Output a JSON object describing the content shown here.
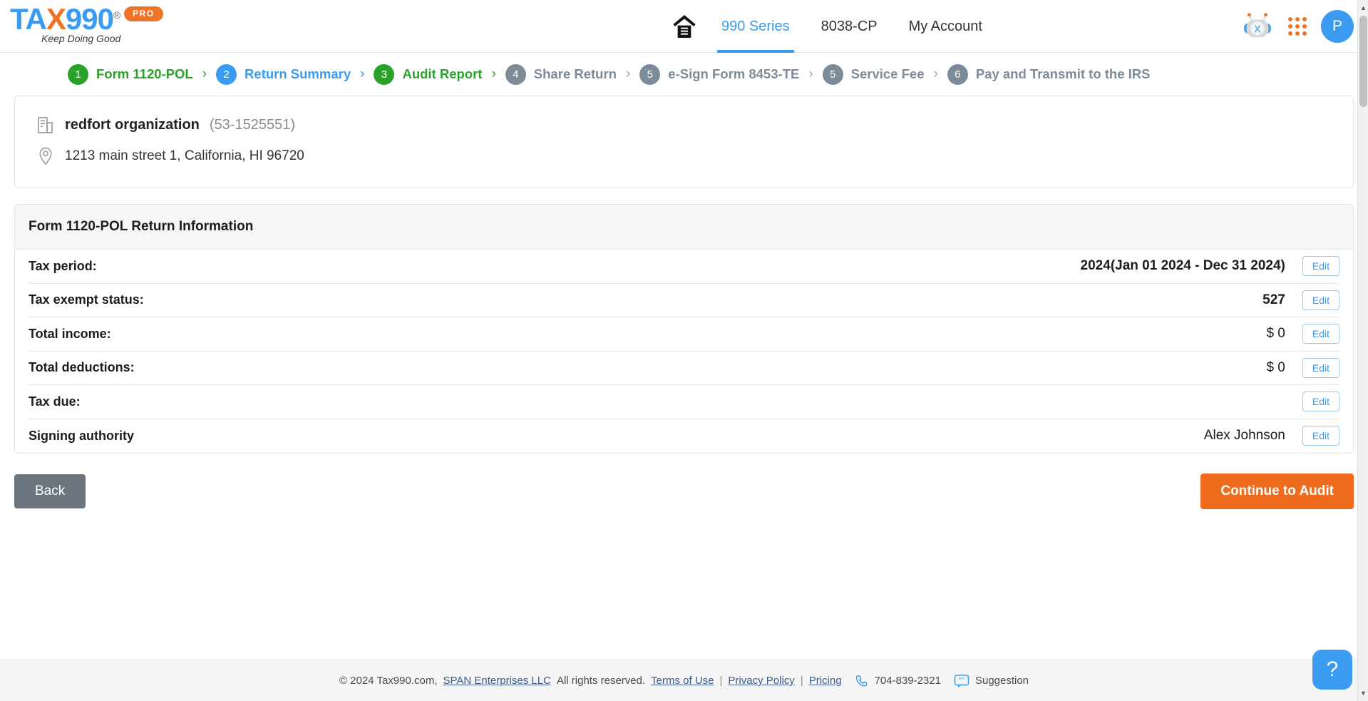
{
  "brand": {
    "logo_text_1": "TA",
    "logo_x": "X",
    "logo_text_2": "990",
    "logo_registered": "®",
    "logo_badge": "PRO",
    "tagline": "Keep Doing Good",
    "accent_blue": "#3a9bf0",
    "accent_orange": "#ee7528",
    "green": "#2aa22a",
    "gray": "#7d8b99"
  },
  "nav": {
    "home_icon": "home-icon",
    "items": [
      {
        "label": "990 Series",
        "active": true
      },
      {
        "label": "8038-CP",
        "active": false
      },
      {
        "label": "My Account",
        "active": false
      }
    ],
    "bot_icon": "chatbot-icon",
    "apps_icon": "apps-grid-icon",
    "avatar_initial": "P"
  },
  "stepper": {
    "steps": [
      {
        "number": "1",
        "label": "Form 1120-POL",
        "state": "done"
      },
      {
        "number": "2",
        "label": "Return Summary",
        "state": "current"
      },
      {
        "number": "3",
        "label": "Audit Report",
        "state": "done"
      },
      {
        "number": "4",
        "label": "Share Return",
        "state": "pending"
      },
      {
        "number": "5",
        "label": "e-Sign Form 8453-TE",
        "state": "pending"
      },
      {
        "number": "5",
        "label": "Service Fee",
        "state": "pending"
      },
      {
        "number": "6",
        "label": "Pay and Transmit to the IRS",
        "state": "pending"
      }
    ]
  },
  "organization": {
    "building_icon": "building-icon",
    "name": "redfort organization",
    "ein": "(53-1525551)",
    "location_icon": "location-pin-icon",
    "address": "1213 main street 1, California, HI 96720"
  },
  "return_info": {
    "title": "Form 1120-POL Return Information",
    "edit_label": "Edit",
    "rows": [
      {
        "label": "Tax period:",
        "value": "2024(Jan 01 2024 - Dec 31 2024)",
        "bold": true
      },
      {
        "label": "Tax exempt status:",
        "value": "527",
        "bold": true
      },
      {
        "label": "Total income:",
        "value": "$ 0",
        "bold": false
      },
      {
        "label": "Total deductions:",
        "value": "$ 0",
        "bold": false
      },
      {
        "label": "Tax due:",
        "value": "",
        "bold": false
      },
      {
        "label": "Signing authority",
        "value": "Alex Johnson",
        "bold": false
      }
    ]
  },
  "actions": {
    "back_label": "Back",
    "continue_label": "Continue to Audit"
  },
  "footer": {
    "copyright": "© 2024 Tax990.com,",
    "company_link": "SPAN Enterprises LLC",
    "rights": "All rights reserved.",
    "terms": "Terms of Use",
    "privacy": "Privacy Policy",
    "pricing": "Pricing",
    "sep": "|",
    "phone_icon": "phone-icon",
    "phone": "704-839-2321",
    "suggestion_icon": "feedback-icon",
    "suggestion": "Suggestion",
    "help_icon": "?"
  }
}
